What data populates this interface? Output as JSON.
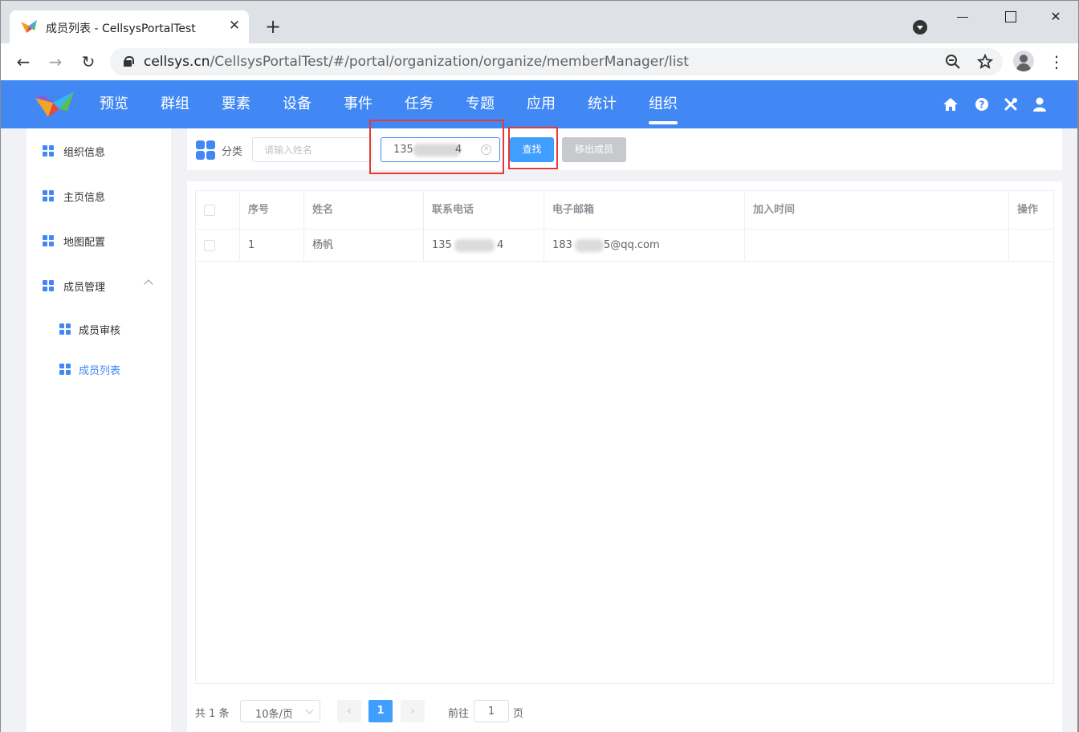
{
  "browser": {
    "tab_title": "成员列表 - CellsysPortalTest",
    "tab_close": "✕",
    "new_tab": "+",
    "url_host": "cellsys.cn",
    "url_path": "/CellsysPortalTest/#/portal/organization/organize/memberManager/list"
  },
  "header": {
    "nav": [
      "预览",
      "群组",
      "要素",
      "设备",
      "事件",
      "任务",
      "专题",
      "应用",
      "统计",
      "组织"
    ],
    "active_nav": "组织",
    "accent_color": "#4188f5"
  },
  "sidebar": {
    "items": [
      {
        "label": "组织信息"
      },
      {
        "label": "主页信息"
      },
      {
        "label": "地图配置"
      },
      {
        "label": "成员管理"
      },
      {
        "label": "成员审核"
      },
      {
        "label": "成员列表"
      }
    ],
    "active": "成员列表"
  },
  "filter": {
    "category_label": "分类",
    "name_placeholder": "请输入姓名",
    "phone_prefix": "135",
    "phone_suffix": "4",
    "search_button": "查找",
    "remove_button": "移出成员"
  },
  "table": {
    "columns": [
      "序号",
      "姓名",
      "联系电话",
      "电子邮箱",
      "加入时间",
      "操作"
    ],
    "rows": [
      {
        "index": "1",
        "name": "杨帆",
        "phone_prefix": "135",
        "phone_suffix": "4",
        "email_prefix": "183",
        "email_suffix": "5@qq.com",
        "joined": "",
        "action": ""
      }
    ]
  },
  "pagination": {
    "total_text": "共 1 条",
    "page_size": "10条/页",
    "prev": "‹",
    "next": "›",
    "current_page": "1",
    "goto_label": "前往",
    "goto_value": "1",
    "goto_unit": "页"
  }
}
